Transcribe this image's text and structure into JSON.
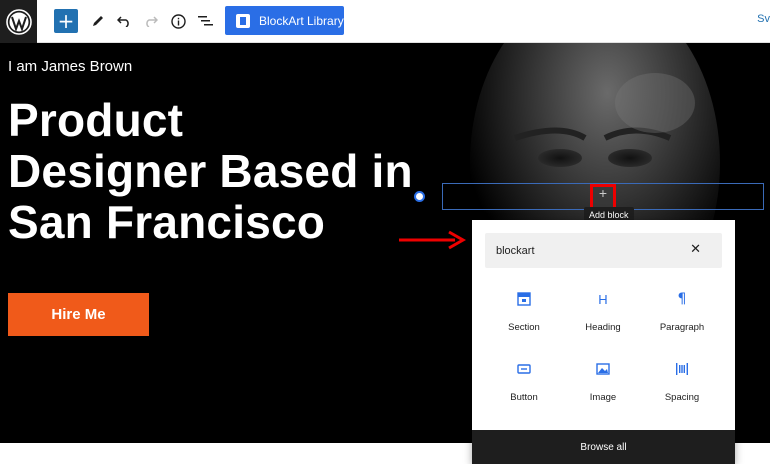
{
  "toolbar": {
    "library_label": "BlockArt Library",
    "right_text": "Sv"
  },
  "hero": {
    "intro": "I am James Brown",
    "headline_lines": [
      "Product",
      "Designer Based in",
      "San Francisco"
    ],
    "cta_label": "Hire Me"
  },
  "tooltip": {
    "label": "Add block"
  },
  "inserter": {
    "search_value": "blockart",
    "blocks": [
      {
        "label": "Section",
        "icon": "section-icon"
      },
      {
        "label": "Heading",
        "icon": "heading-icon"
      },
      {
        "label": "Paragraph",
        "icon": "paragraph-icon"
      },
      {
        "label": "Button",
        "icon": "button-icon"
      },
      {
        "label": "Image",
        "icon": "image-icon"
      },
      {
        "label": "Spacing",
        "icon": "spacing-icon"
      }
    ],
    "browse_label": "Browse all"
  },
  "colors": {
    "accent": "#2a6ee6",
    "cta": "#f05a1a",
    "annotation": "#e00000"
  }
}
